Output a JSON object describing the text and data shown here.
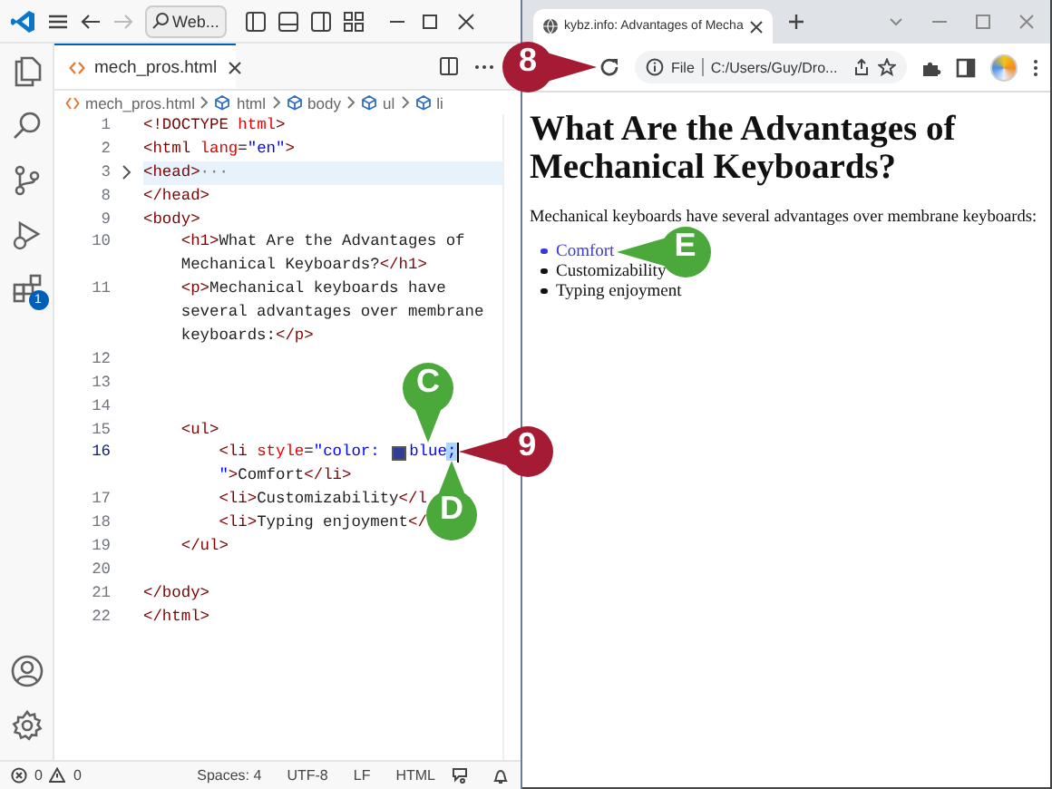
{
  "editor": {
    "titlebar": {
      "search": "Web..."
    },
    "activity_bar": {
      "extensions_badge": "1"
    },
    "tab": {
      "label": "mech_pros.html"
    },
    "breadcrumbs": [
      "mech_pros.html",
      "html",
      "body",
      "ul",
      "li"
    ],
    "lines": [
      {
        "number": "1",
        "segments": [
          {
            "kind": "tag",
            "text": "<!DOCTYPE "
          },
          {
            "kind": "attr",
            "text": "html"
          },
          {
            "kind": "tag",
            "text": ">"
          }
        ]
      },
      {
        "number": "2",
        "segments": [
          {
            "kind": "tag",
            "text": "<html "
          },
          {
            "kind": "attr",
            "text": "lang"
          },
          {
            "kind": "text",
            "text": "="
          },
          {
            "kind": "value",
            "text": "\"en\""
          },
          {
            "kind": "tag",
            "text": ">"
          }
        ]
      },
      {
        "number": "3",
        "folded": true,
        "segments": [
          {
            "kind": "tag",
            "text": "<head>"
          },
          {
            "kind": "fold",
            "text": "···"
          }
        ]
      },
      {
        "number": "8",
        "segments": [
          {
            "kind": "tag",
            "text": "</head>"
          }
        ]
      },
      {
        "number": "9",
        "segments": [
          {
            "kind": "tag",
            "text": "<body>"
          }
        ]
      },
      {
        "number": "10",
        "segments": [
          {
            "kind": "tag",
            "text": "    <h1>"
          },
          {
            "kind": "text",
            "text": "What Are the Advantages of"
          }
        ]
      },
      {
        "segments": [
          {
            "kind": "text",
            "text": "    Mechanical Keyboards?"
          },
          {
            "kind": "tag",
            "text": "</h1>"
          }
        ]
      },
      {
        "number": "11",
        "segments": [
          {
            "kind": "tag",
            "text": "    <p>"
          },
          {
            "kind": "text",
            "text": "Mechanical keyboards have"
          }
        ]
      },
      {
        "segments": [
          {
            "kind": "text",
            "text": "    several advantages over membrane"
          }
        ]
      },
      {
        "segments": [
          {
            "kind": "text",
            "text": "    keyboards:"
          },
          {
            "kind": "tag",
            "text": "</p>"
          }
        ]
      },
      {
        "number": "12"
      },
      {
        "number": "13"
      },
      {
        "number": "14"
      },
      {
        "number": "15",
        "segments": [
          {
            "kind": "tag",
            "text": "    <ul>"
          }
        ]
      },
      {
        "number": "16",
        "active": true,
        "cursor": true,
        "segments": [
          {
            "kind": "tag",
            "text": "        <li "
          },
          {
            "kind": "attr",
            "text": "style"
          },
          {
            "kind": "text",
            "text": "="
          },
          {
            "kind": "value",
            "text": "\"color: "
          },
          {
            "kind": "swatch",
            "color": "#2e3f95"
          },
          {
            "kind": "value",
            "text": "blue",
            "callouts": [
              {
                "label": "C",
                "kind": "above",
                "color": "#4ba83a"
              }
            ]
          },
          {
            "kind": "selection",
            "text": ";",
            "callouts": [
              {
                "label": "9",
                "kind": "right",
                "color": "#a51b33"
              },
              {
                "label": "D",
                "kind": "below",
                "color": "#4ba83a"
              }
            ]
          }
        ]
      },
      {
        "segments": [
          {
            "kind": "value",
            "text": "        \""
          },
          {
            "kind": "tag",
            "text": ">"
          },
          {
            "kind": "text",
            "text": "Comfort"
          },
          {
            "kind": "tag",
            "text": "</li>"
          }
        ]
      },
      {
        "number": "17",
        "segments": [
          {
            "kind": "tag",
            "text": "        <li>"
          },
          {
            "kind": "text",
            "text": "Customizability"
          },
          {
            "kind": "tag",
            "text": "</l"
          }
        ]
      },
      {
        "number": "18",
        "segments": [
          {
            "kind": "tag",
            "text": "        <li>"
          },
          {
            "kind": "text",
            "text": "Typing enjoyment"
          },
          {
            "kind": "tag",
            "text": "</"
          }
        ]
      },
      {
        "number": "19",
        "segments": [
          {
            "kind": "tag",
            "text": "    </ul>"
          }
        ]
      },
      {
        "number": "20"
      },
      {
        "number": "21",
        "segments": [
          {
            "kind": "tag",
            "text": "</body>"
          }
        ]
      },
      {
        "number": "22",
        "segments": [
          {
            "kind": "tag",
            "text": "</html>"
          }
        ]
      }
    ],
    "status_bar": {
      "errors": "0",
      "warnings": "0",
      "items": [
        "Spaces: 4",
        "UTF-8",
        "LF",
        "HTML"
      ]
    }
  },
  "browser": {
    "tab": {
      "title": "kybz.info: Advantages of Mecha"
    },
    "toolbar": {
      "reload_callouts": [
        {
          "label": "8",
          "kind": "left",
          "color": "#a51b33"
        }
      ],
      "scheme": "File",
      "address": "C:/Users/Guy/Dro..."
    },
    "page": {
      "heading": "What Are the Advantages of Mechanical Keyboards?",
      "paragraph": "Mechanical keyboards have several advantages over membrane keyboards:",
      "list": [
        {
          "text": "Comfort",
          "color": "#3a3ad0",
          "callouts": [
            {
              "label": "E",
              "kind": "right",
              "color": "#4ba83a"
            }
          ]
        },
        {
          "text": "Customizability",
          "color": "#111111"
        },
        {
          "text": "Typing enjoyment",
          "color": "#111111"
        }
      ]
    }
  }
}
